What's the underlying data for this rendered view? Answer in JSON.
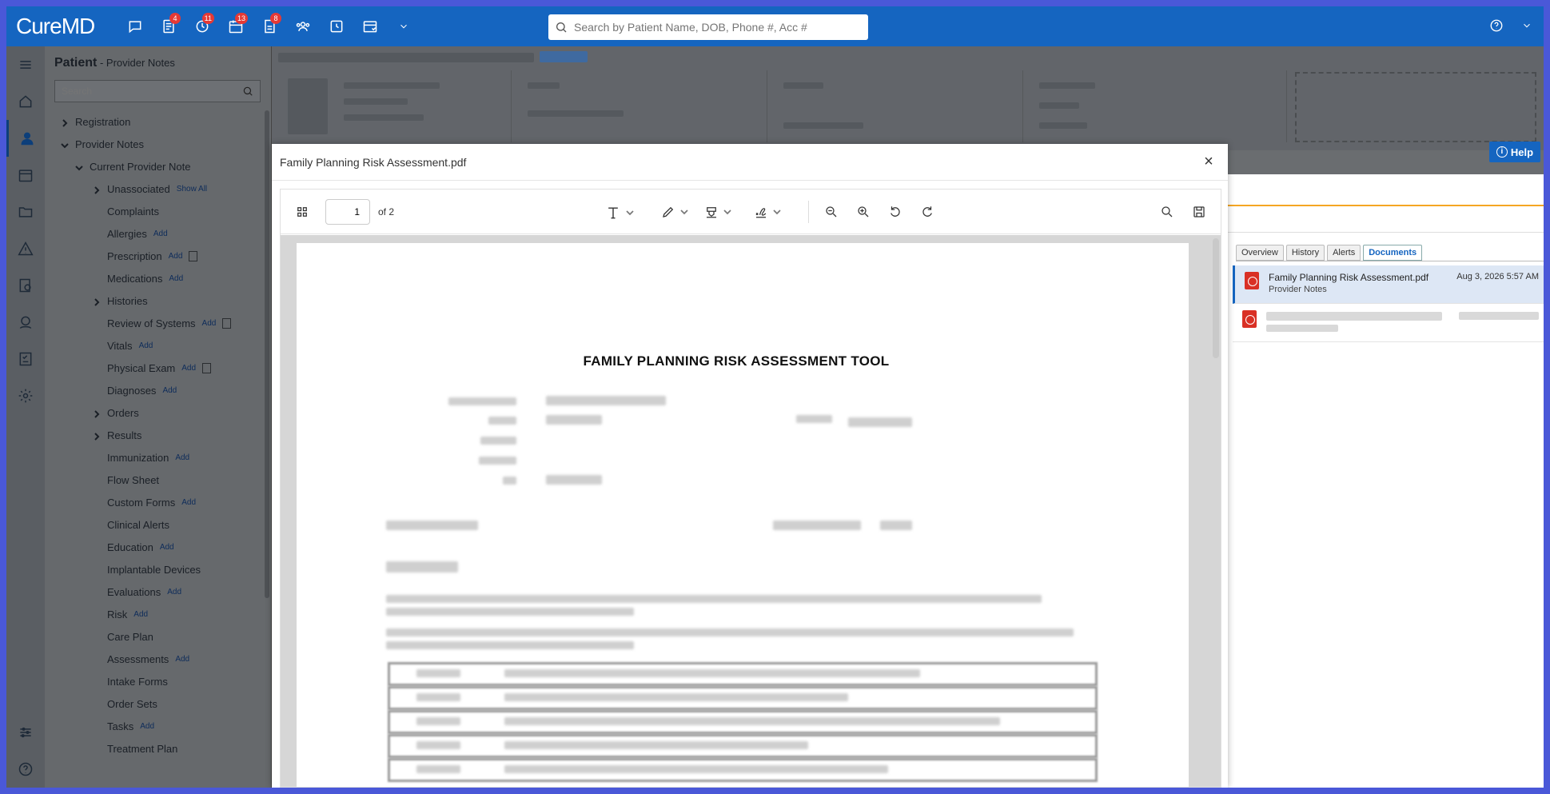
{
  "app": {
    "logo": "CureMD"
  },
  "topbar": {
    "badges": {
      "tasks": "4",
      "messages": "11",
      "calendar": "13",
      "docs": "8"
    },
    "search_placeholder": "Search by Patient Name, DOB, Phone #, Acc #"
  },
  "sidenav": {
    "title": "Patient",
    "subtitle": " - Provider Notes",
    "search_placeholder": "Search",
    "items": [
      {
        "label": "Registration"
      },
      {
        "label": "Provider Notes"
      },
      {
        "label": "Current Provider Note"
      },
      {
        "label": "Unassociated",
        "action": "Show All"
      },
      {
        "label": "Complaints"
      },
      {
        "label": "Allergies",
        "action": "Add"
      },
      {
        "label": "Prescription",
        "action": "Add"
      },
      {
        "label": "Medications",
        "action": "Add"
      },
      {
        "label": "Histories"
      },
      {
        "label": "Review of Systems",
        "action": "Add"
      },
      {
        "label": "Vitals",
        "action": "Add"
      },
      {
        "label": "Physical Exam",
        "action": "Add"
      },
      {
        "label": "Diagnoses",
        "action": "Add"
      },
      {
        "label": "Orders"
      },
      {
        "label": "Results"
      },
      {
        "label": "Immunization",
        "action": "Add"
      },
      {
        "label": "Flow Sheet"
      },
      {
        "label": "Custom Forms",
        "action": "Add"
      },
      {
        "label": "Clinical Alerts"
      },
      {
        "label": "Education",
        "action": "Add"
      },
      {
        "label": "Implantable Devices"
      },
      {
        "label": "Evaluations",
        "action": "Add"
      },
      {
        "label": "Risk",
        "action": "Add"
      },
      {
        "label": "Care Plan"
      },
      {
        "label": "Assessments",
        "action": "Add"
      },
      {
        "label": "Intake Forms"
      },
      {
        "label": "Order Sets"
      },
      {
        "label": "Tasks",
        "action": "Add"
      },
      {
        "label": "Treatment Plan"
      }
    ]
  },
  "help": {
    "label": "Help"
  },
  "doc_panel": {
    "tabs": [
      "Overview",
      "History",
      "Alerts",
      "Documents"
    ],
    "documents": [
      {
        "name": "Family Planning Risk Assessment.pdf",
        "category": "Provider Notes",
        "date": "Aug 3, 2026 5:57 AM"
      }
    ]
  },
  "modal": {
    "title": "Family Planning Risk Assessment.pdf",
    "close": "×",
    "page_current": "1",
    "page_total": "of 2",
    "pdf_heading": "FAMILY PLANNING RISK ASSESSMENT TOOL"
  }
}
